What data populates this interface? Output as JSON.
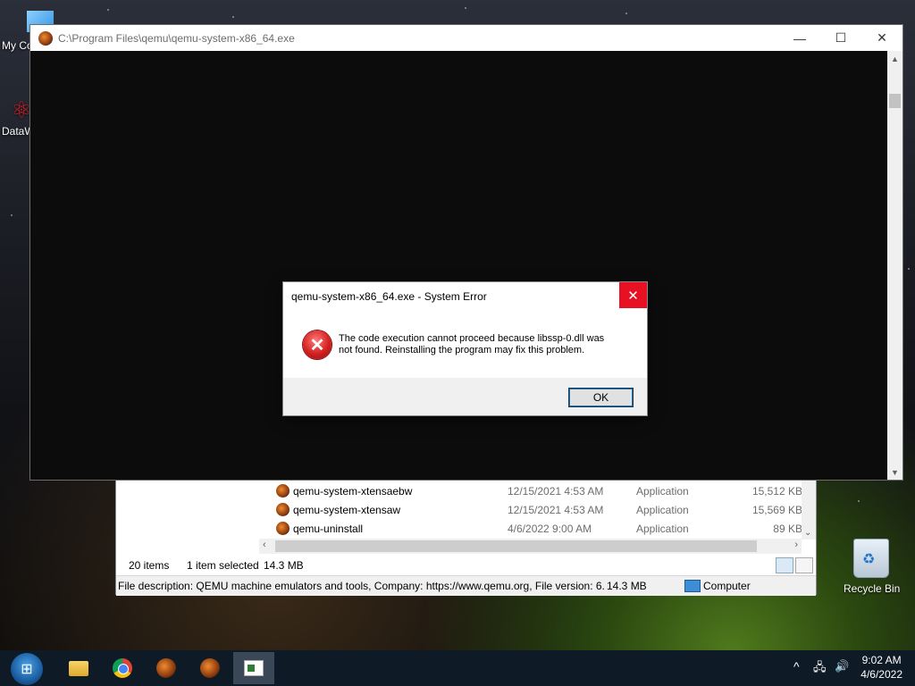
{
  "desktop": {
    "icons": [
      {
        "label": "My Co"
      },
      {
        "label": "DataW"
      },
      {
        "label": "Recycle Bin"
      }
    ]
  },
  "console_window": {
    "title": "C:\\Program Files\\qemu\\qemu-system-x86_64.exe",
    "minimize_glyph": "—",
    "maximize_glyph": "☐",
    "close_glyph": "✕"
  },
  "dialog": {
    "title": "qemu-system-x86_64.exe - System Error",
    "close_glyph": "✕",
    "message_line1": "The code execution cannot proceed because libssp-0.dll was",
    "message_line2": "not found. Reinstalling the program may fix this problem.",
    "ok_label": "OK",
    "icon": "error-icon"
  },
  "explorer": {
    "files": [
      {
        "name": "qemu-system-xtensaebw",
        "date": "12/15/2021 4:53 AM",
        "type": "Application",
        "size": "15,512 KB"
      },
      {
        "name": "qemu-system-xtensaw",
        "date": "12/15/2021 4:53 AM",
        "type": "Application",
        "size": "15,569 KB"
      },
      {
        "name": "qemu-uninstall",
        "date": "4/6/2022 9:00 AM",
        "type": "Application",
        "size": "89 KB"
      }
    ],
    "status": {
      "item_count": "20 items",
      "selected": "1 item selected",
      "selected_size": "14.3 MB"
    },
    "description": {
      "text": "File description: QEMU machine emulators and tools, Company: https://www.qemu.org, File version: 6.",
      "size": "14.3 MB",
      "location": "Computer"
    }
  },
  "taskbar": {
    "time": "9:02 AM",
    "date": "4/6/2022",
    "apps": [
      "file-explorer-icon",
      "chrome-icon",
      "qemu-icon",
      "qemu-icon",
      "console-icon"
    ]
  }
}
